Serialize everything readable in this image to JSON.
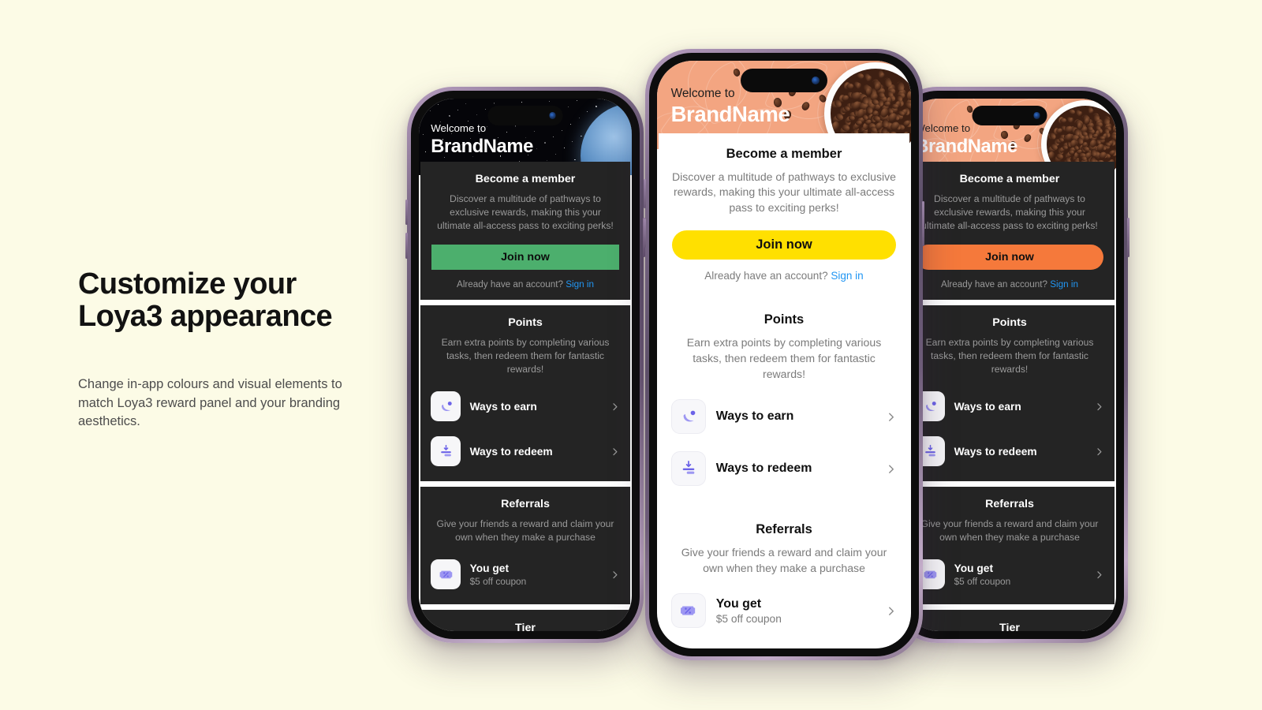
{
  "background_color": "#FCFBE6",
  "copy": {
    "heading_line1": "Customize your",
    "heading_line2": "Loya3 appearance",
    "body": "Change in-app colours and visual elements to match Loya3 reward panel and your branding aesthetics."
  },
  "app": {
    "hero": {
      "welcome": "Welcome to",
      "brand": "BrandName"
    },
    "member": {
      "title": "Become a member",
      "description": "Discover a multitude of pathways to exclusive rewards, making this your ultimate all-access pass to exciting perks!",
      "cta": "Join now",
      "signin_prefix": "Already have an account?",
      "signin_link": "Sign in"
    },
    "points": {
      "title": "Points",
      "description": "Earn extra points by completing various tasks, then redeem them for fantastic rewards!",
      "rows": [
        {
          "label": "Ways to earn",
          "icon": "ways-to-earn-icon"
        },
        {
          "label": "Ways to redeem",
          "icon": "ways-to-redeem-icon"
        }
      ]
    },
    "referrals": {
      "title": "Referrals",
      "description": "Give your friends a reward and claim your own when they make a purchase",
      "rows": [
        {
          "label": "You get",
          "sub": "$5 off coupon",
          "icon": "coupon-percent-icon"
        }
      ]
    },
    "tier": {
      "title": "Tier"
    }
  },
  "phones": [
    {
      "id": "left",
      "theme": "dark",
      "hero_style": "space",
      "accent": "#4CAF6D",
      "cta_text_color": "#0d0d0d",
      "cta_radius": "0px"
    },
    {
      "id": "center",
      "theme": "light",
      "hero_style": "coffee",
      "accent": "#FFE000",
      "cta_text_color": "#101010",
      "cta_radius": "999px"
    },
    {
      "id": "right",
      "theme": "dark",
      "hero_style": "coffee",
      "accent": "#F5793B",
      "cta_text_color": "#101010",
      "cta_radius": "999px"
    }
  ],
  "icons": {
    "lens": "camera-lens-icon",
    "chevron": "chevron-right-icon",
    "island": "dynamic-island"
  }
}
